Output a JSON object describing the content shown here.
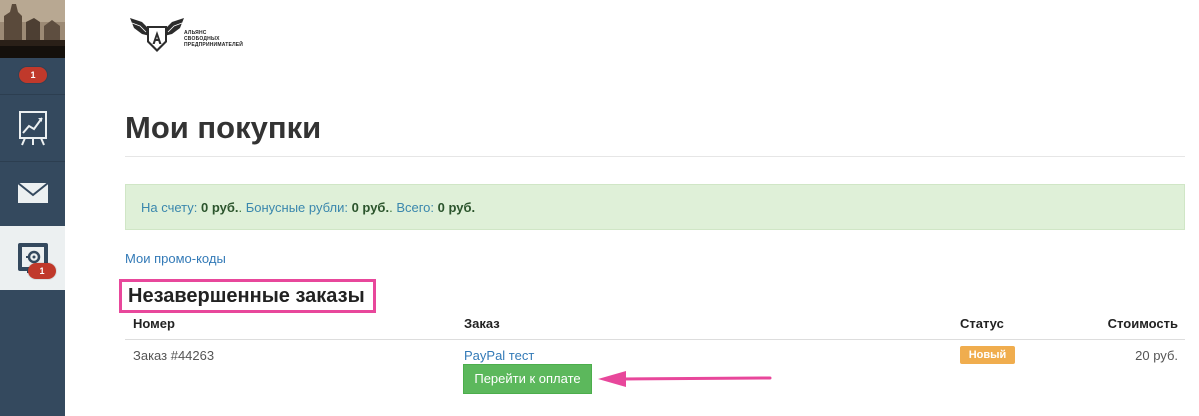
{
  "sidebar": {
    "avatar_badge": "1",
    "settings_badge": "1",
    "items": [
      {
        "name": "stats",
        "icon": "chart-board-icon"
      },
      {
        "name": "messages",
        "icon": "envelope-icon"
      },
      {
        "name": "settings",
        "icon": "settings-gear-icon"
      }
    ]
  },
  "logo": {
    "icon": "winged-shield-a-icon",
    "text_line1": "Альянс",
    "text_line2": "свободных",
    "text_line3": "предпринимателей"
  },
  "page": {
    "title": "Мои покупки"
  },
  "balance": {
    "account_label": "На счету:",
    "account_value": "0 руб.",
    "bonus_label": "Бонусные рубли:",
    "bonus_value": "0 руб.",
    "total_label": "Всего:",
    "total_value": "0 руб."
  },
  "promo_link": "Мои промо-коды",
  "orders": {
    "section_title": "Незавершенные заказы",
    "columns": {
      "number": "Номер",
      "order": "Заказ",
      "status": "Статус",
      "cost": "Стоимость"
    },
    "rows": [
      {
        "number": "Заказ #44263",
        "order": "PayPal тест",
        "pay_button": "Перейти к оплате",
        "status": "Новый",
        "cost": "20 руб."
      }
    ]
  },
  "colors": {
    "sidebar": "#34495e",
    "badge": "#c0392b",
    "annotation": "#e8479b",
    "status_new": "#f0ad4e",
    "pay_button": "#5cb85c",
    "alert_bg": "#dff0d8"
  }
}
